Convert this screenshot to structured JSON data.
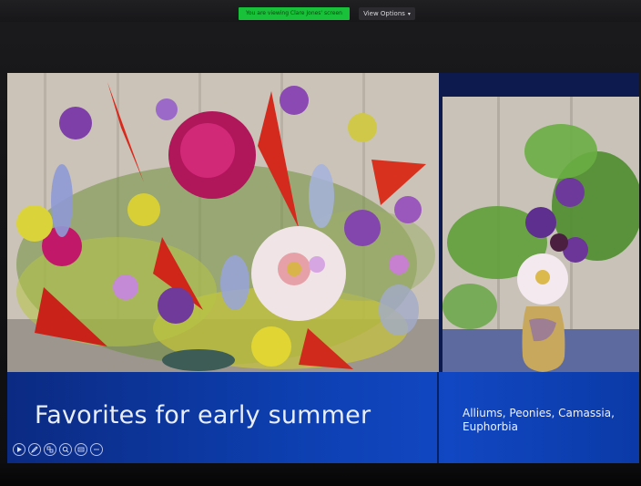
{
  "meeting": {
    "share_banner": "You are viewing Clare Jones' screen",
    "view_options_label": "View Options",
    "view_options_icon": "chevron-down-icon"
  },
  "slide": {
    "title": "Favorites for early summer",
    "subtitle": "Alliums, Peonies, Camassia, Euphorbia",
    "colors": {
      "caption_bar": "#0d3fb0",
      "title_text": "#e9eefc"
    }
  },
  "presenter_controls": [
    {
      "name": "play-icon"
    },
    {
      "name": "pen-icon"
    },
    {
      "name": "slides-icon"
    },
    {
      "name": "zoom-icon"
    },
    {
      "name": "subtitles-icon"
    },
    {
      "name": "more-icon"
    }
  ]
}
